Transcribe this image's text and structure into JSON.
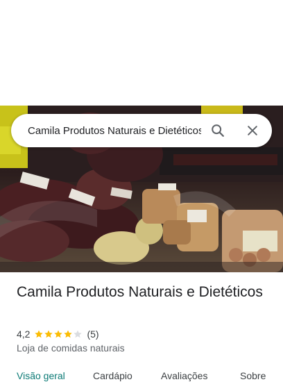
{
  "search": {
    "value": "Camila Produtos Naturais e Dietéticos",
    "search_icon": "search-icon",
    "clear_icon": "close-icon"
  },
  "hero": {
    "photo_description_icon": "store-photo"
  },
  "place": {
    "name": "Camila Produtos Naturais e Dietéticos",
    "rating": "4,2",
    "rating_value": 4.2,
    "stars_filled": 4,
    "stars_total": 5,
    "review_count": "(5)",
    "category": "Loja de comidas naturais"
  },
  "tabs": [
    {
      "label": "Visão geral",
      "active": true
    },
    {
      "label": "Cardápio",
      "active": false
    },
    {
      "label": "Avaliações",
      "active": false
    },
    {
      "label": "Sobre",
      "active": false
    }
  ],
  "colors": {
    "accent": "#0b7a75",
    "star": "#fbbc04",
    "star_empty": "#dadce0"
  }
}
